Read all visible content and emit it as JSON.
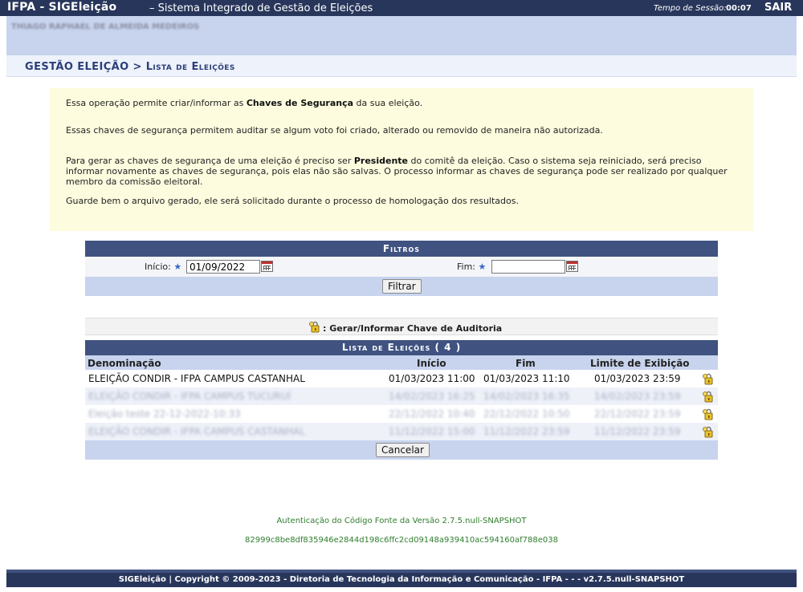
{
  "header": {
    "app_title": "IFPA - SIGEleição",
    "app_subtitle": "– Sistema Integrado de Gestão de Eleições",
    "session_label": "Tempo de Sessão:",
    "session_time": "00:07",
    "logout": "SAIR"
  },
  "user": {
    "name": "THIAGO RAPHAEL DE ALMEIDA MEDEIROS"
  },
  "breadcrumb": {
    "parent": "GESTÃO ELEIÇÃO",
    "separator": ">",
    "current": "Lista de Eleições"
  },
  "info": {
    "p1_pre": "Essa operação permite criar/informar as ",
    "p1_bold": "Chaves de Segurança",
    "p1_post": " da sua eleição.",
    "p2": "Essas chaves de segurança permitem auditar se algum voto foi criado, alterado ou removido de maneira não autorizada.",
    "p3_pre": "Para gerar as chaves de segurança de uma eleição é preciso ser ",
    "p3_bold": "Presidente",
    "p3_post": " do comitê da eleição. Caso o sistema seja reiniciado, será preciso informar novamente as chaves de segurança, pois elas não são salvas. O processo informar as chaves de segurança pode ser realizado por qualquer membro da comissão eleitoral.",
    "p4": "Guarde bem o arquivo gerado, ele será solicitado durante o processo de homologação dos resultados."
  },
  "filters": {
    "caption": "Filtros",
    "start_label": "Início:",
    "start_value": "01/09/2022",
    "end_label": "Fim:",
    "end_value": "",
    "filter_button": "Filtrar"
  },
  "legend": {
    "text": ": Gerar/Informar Chave de Auditoria",
    "icon": "key-lock-icon"
  },
  "list": {
    "caption": "Lista de Eleições ( 4 )",
    "columns": [
      "Denominação",
      "Início",
      "Fim",
      "Limite de Exibição"
    ],
    "rows": [
      {
        "name": "ELEIÇÃO CONDIR - IFPA CAMPUS CASTANHAL",
        "start": "01/03/2023 11:00",
        "end": "01/03/2023 11:10",
        "limit": "01/03/2023 23:59"
      },
      {
        "name": "ELEIÇÃO CONDIR - IFPA CAMPUS TUCURUÍ",
        "start": "14/02/2023 16:25",
        "end": "14/02/2023 16:35",
        "limit": "14/02/2023 23:59"
      },
      {
        "name": "Eleição teste 22-12-2022-10:33",
        "start": "22/12/2022 10:40",
        "end": "22/12/2022 10:50",
        "limit": "22/12/2022 23:59"
      },
      {
        "name": "ELEIÇÃO CONDIR - IFPA CAMPUS CASTANHAL",
        "start": "11/12/2022 15:00",
        "end": "11/12/2022 23:59",
        "limit": "11/12/2022 23:59"
      }
    ],
    "cancel_button": "Cancelar"
  },
  "footer": {
    "auth_text": "Autenticação do Código Fonte da Versão 2.7.5.null-SNAPSHOT",
    "hash": "82999c8be8df835946e2844d198c6ffc2cd09148a939410ac594160af788e038",
    "copyright": "SIGEleição | Copyright © 2009-2023 - Diretoria de Tecnologia da Informação e Comunicação - IFPA - - - v2.7.5.null-SNAPSHOT"
  },
  "colors": {
    "header_bg": "#28365b",
    "section_bg": "#3f5280",
    "light_blue": "#c8d4ee",
    "info_bg": "#fdfcdf",
    "footer_text": "#2e7d2e"
  }
}
